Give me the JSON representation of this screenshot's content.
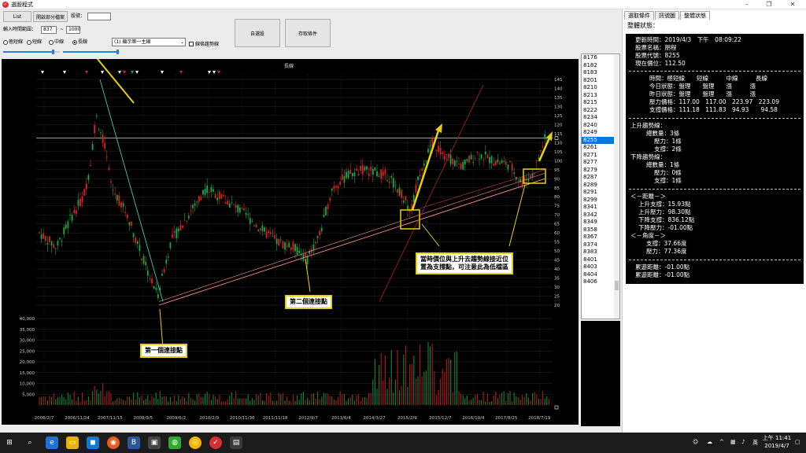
{
  "window": {
    "title": "選股程式"
  },
  "controls": {
    "list_button": "List",
    "open_file_button": "開啟部分檔案",
    "stock_id_label": "股號：",
    "stock_id_value": "",
    "range_label": "輸入時間範圍：",
    "range_from": "837",
    "range_sep": "~",
    "range_to": "1000",
    "radio_options": [
      "極短線",
      "短線",
      "中線",
      "長線"
    ],
    "radio_selected": 3,
    "display_select": "(1) 顯示第一主線",
    "trendline_checkbox": "線條趨勢線",
    "auto_select_button": "自選股",
    "save_button": "存取條件"
  },
  "chart": {
    "title": "長線",
    "price_ticks": [
      "145",
      "140",
      "135",
      "130",
      "125",
      "120",
      "115",
      "110",
      "105",
      "100",
      "95",
      "90",
      "85",
      "80",
      "75",
      "70",
      "65",
      "60",
      "55",
      "50",
      "45",
      "40",
      "35",
      "30",
      "25",
      "20"
    ],
    "volume_ticks": [
      "40,000",
      "35,000",
      "30,000",
      "25,000",
      "20,000",
      "15,000",
      "10,000",
      "5,000"
    ],
    "date_ticks": [
      "2006/2/7",
      "2006/11/24",
      "2007/11/15",
      "2008/9/5",
      "2009/6/2",
      "2010/2/9",
      "2010/11/30",
      "2011/11/18",
      "2012/9/7",
      "2013/6/4",
      "2014/3/27",
      "2015/2/9",
      "2015/12/7",
      "2016/10/4",
      "2017/8/25",
      "2018/7/19"
    ]
  },
  "annotations": {
    "first_point": "第一個連接點",
    "second_point": "第二個連接點",
    "support_line1": "當時價位與上升去趨勢線接近位",
    "support_line2": "置為支撐點，可注意此為低檔區"
  },
  "stock_list": {
    "items": [
      "8176",
      "8182",
      "8183",
      "8201",
      "8210",
      "8213",
      "8215",
      "8222",
      "8234",
      "8240",
      "8249",
      "8255",
      "8261",
      "8271",
      "8277",
      "8279",
      "8287",
      "8289",
      "8291",
      "8299",
      "8341",
      "8342",
      "8349",
      "8358",
      "8367",
      "8374",
      "8383",
      "8401",
      "8403",
      "8404",
      "8406"
    ],
    "selected": "8255"
  },
  "right_panel": {
    "tabs": [
      "選取條件",
      "訊號圖",
      "整體狀態"
    ],
    "active_tab": 2,
    "section_title": "整體狀態：",
    "update_time": "更新時間：2019/4/3　下午　08:09:22",
    "stock_name": "股票名稱：朋程",
    "stock_code": "股票代號：8255",
    "current_price": "現在價位：112.50",
    "table_header": "時間：極短線　　短線　　　中線　　　長線",
    "today_status": "今日狀態：盤理　　盤理　　漲　　　漲",
    "yesterday_status": "昨日狀態：盤理　　盤理　　漲　　　漲",
    "resistance_price": "壓力價格：117.00　117.00　223.97　223.09",
    "support_price": "支撐價格：111.18　111.83　94.93　　94.58",
    "up_trend_title": "上升趨勢線：",
    "up_total": "總數量：3條",
    "up_pressure": "壓力：1條",
    "up_support": "支撐：2條",
    "down_trend_title": "下降趨勢線：",
    "down_total": "總數量：1條",
    "down_pressure": "壓力：0條",
    "down_support": "支撐：1條",
    "distance_title": "＜－距離－＞",
    "up_support_dist": "上升支撐：15.93點",
    "up_pressure_dist": "上升壓力：98.30點",
    "down_support_dist": "下降支撐：836.12點",
    "down_pressure_dist": "下降壓力：-01.00點",
    "angle_title": "＜－角度－＞",
    "support_angle": "支撐：37.66度",
    "pressure_angle": "壓力：77.36度",
    "cum_dist": "累遊距離：-01.00點",
    "cum_dist2": "累遊距離：-01.00點"
  },
  "taskbar": {
    "time_period": "上午 11:41",
    "date": "2019/4/7",
    "ime": "英"
  },
  "colors": {
    "up_candle": "#e02020",
    "down_candle": "#1aa84a",
    "trend_line": "#ff9090",
    "highlight": "#e6d20a",
    "selection": "#0078d7"
  }
}
